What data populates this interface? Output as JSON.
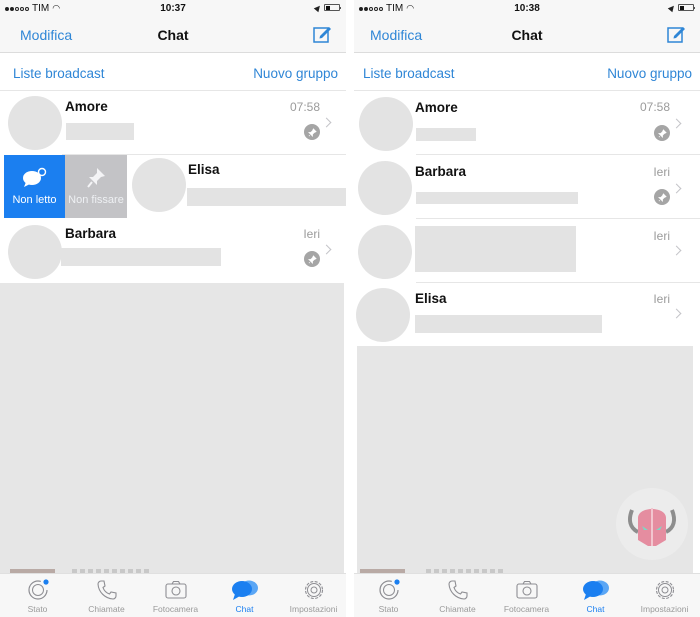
{
  "screens": [
    {
      "status": {
        "carrier": "TIM",
        "time": "10:37"
      },
      "nav": {
        "edit": "Modifica",
        "title": "Chat"
      },
      "links": {
        "broadcast": "Liste broadcast",
        "new_group": "Nuovo gruppo"
      },
      "chats": [
        {
          "name": "Amore",
          "time": "07:58",
          "pinned": true
        },
        {
          "name": "Elisa",
          "time": "",
          "pinned": false,
          "swiped": true
        },
        {
          "name": "Barbara",
          "time": "Ieri",
          "pinned": true
        }
      ],
      "swipe_actions": {
        "unread": "Non letto",
        "unpin": "Non fissare"
      }
    },
    {
      "status": {
        "carrier": "TIM",
        "time": "10:38"
      },
      "nav": {
        "edit": "Modifica",
        "title": "Chat"
      },
      "links": {
        "broadcast": "Liste broadcast",
        "new_group": "Nuovo gruppo"
      },
      "chats": [
        {
          "name": "Amore",
          "time": "07:58",
          "pinned": true
        },
        {
          "name": "Barbara",
          "time": "Ieri",
          "pinned": true
        },
        {
          "name": "",
          "time": "Ieri",
          "pinned": false
        },
        {
          "name": "Elisa",
          "time": "Ieri",
          "pinned": false
        }
      ]
    }
  ],
  "tabs": [
    {
      "label": "Stato",
      "icon": "status-icon"
    },
    {
      "label": "Chiamate",
      "icon": "phone-icon"
    },
    {
      "label": "Fotocamera",
      "icon": "camera-icon"
    },
    {
      "label": "Chat",
      "icon": "chat-bubbles-icon",
      "active": true
    },
    {
      "label": "Impostazioni",
      "icon": "gear-icon"
    }
  ],
  "colors": {
    "accent": "#1b7ff0",
    "link": "#2f86d6",
    "unpin_action": "#c3c3c6"
  }
}
